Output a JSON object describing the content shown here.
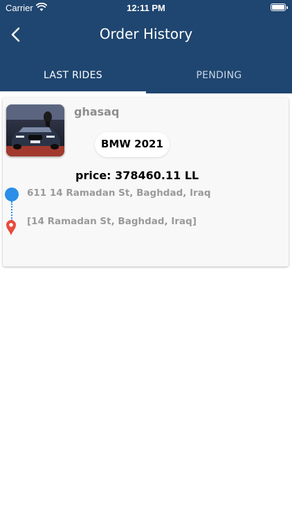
{
  "status_bar": {
    "carrier": "Carrier",
    "time": "12:11 PM",
    "wifi_icon": "wifi-icon",
    "battery_icon": "battery-icon"
  },
  "header": {
    "title": "Order History",
    "back_icon": "chevron-left-icon",
    "background": "#1f4670"
  },
  "tabs": [
    {
      "label": "LAST RIDES",
      "active": true
    },
    {
      "label": "PENDING",
      "active": false
    }
  ],
  "ride": {
    "username": "ghasaq",
    "car_model": "BMW  2021",
    "price": "price: 378460.11 LL",
    "pickup_address": "611 14 Ramadan St, Baghdad, Iraq",
    "dropoff_address": "[14 Ramadan St, Baghdad, Iraq]",
    "pickup_icon": "pickup-dot-icon",
    "dropoff_icon": "map-pin-icon",
    "pickup_color": "#2b8ee8",
    "dropoff_color": "#e84a3c"
  }
}
